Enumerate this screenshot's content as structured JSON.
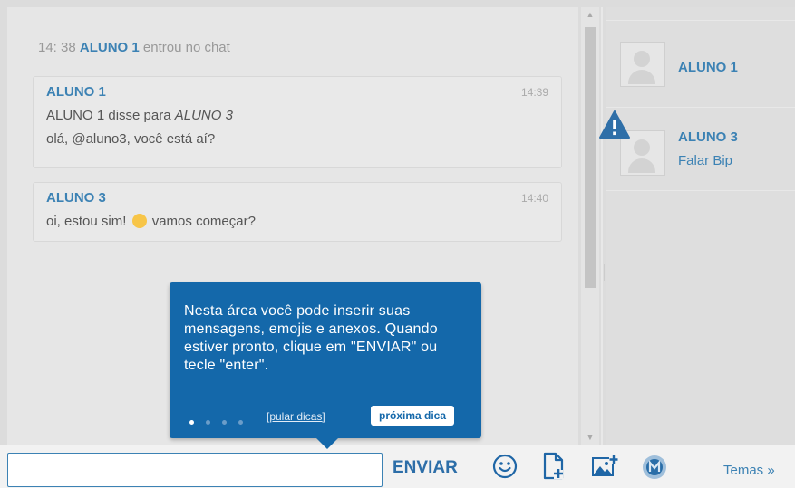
{
  "chat": {
    "system_line": {
      "time": "14: 38",
      "name": "ALUNO 1",
      "text": "entrou no chat"
    },
    "messages": [
      {
        "author": "ALUNO 1",
        "time": "14:39",
        "line1_prefix": "ALUNO 1 disse para ",
        "line1_target": "ALUNO 3",
        "line2": "olá, @aluno3, você está aí?"
      },
      {
        "author": "ALUNO 3",
        "time": "14:40",
        "text_before_emoji": "oi, estou sim!",
        "text_after_emoji": "vamos começar?",
        "emoji_icon": "smiley-emoji-icon"
      }
    ]
  },
  "users": [
    {
      "name": "ALUNO 1",
      "status": ""
    },
    {
      "name": "ALUNO 3",
      "status": "Falar Bip",
      "badge_icon": "warning-icon"
    }
  ],
  "tooltip": {
    "text": "Nesta área você pode inserir suas mensagens, emojis e anexos. Quando estiver pronto, clique em \"ENVIAR\" ou tecle \"enter\".",
    "skip_label": "[pular dicas]",
    "next_label": "próxima dica",
    "step": 1,
    "total_steps": 4
  },
  "composer": {
    "input_value": "",
    "send_label": "ENVIAR",
    "icons": [
      "emoji-icon",
      "attach-file-icon",
      "attach-image-icon",
      "theme-avatar-icon"
    ],
    "themes_label": "Temas »"
  },
  "colors": {
    "accent": "#3c82b4",
    "tooltip_bg": "#1468aa",
    "warning": "#2f6fa8"
  }
}
